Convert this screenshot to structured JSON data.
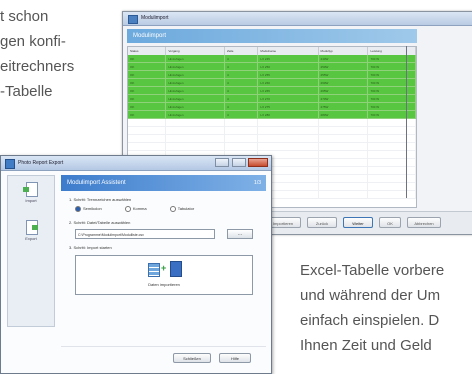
{
  "prose_top": [
    "t schon",
    "gen konfi-",
    "eitrechners",
    "-Tabelle"
  ],
  "prose_bottom": [
    "Excel-Tabelle vorbere",
    "und während der Um",
    "einfach einspielen. D",
    "Ihnen Zeit und Geld"
  ],
  "back_window": {
    "title": "Modulimport",
    "banner": "Modulimport",
    "columns": [
      "Status",
      "Vorgang",
      "Zeile",
      "Modulname",
      "Modultyp",
      "Leistung"
    ],
    "rows": [
      [
        "OK",
        "Hinzufügen",
        "4",
        "LX 245",
        "240W",
        "700 W"
      ],
      [
        "OK",
        "Hinzufügen",
        "4",
        "LX 250",
        "250W",
        "700 W"
      ],
      [
        "OK",
        "Hinzufügen",
        "4",
        "LX 255",
        "255W",
        "700 W"
      ],
      [
        "OK",
        "Hinzufügen",
        "4",
        "LX 260",
        "260W",
        "700 W"
      ],
      [
        "OK",
        "Hinzufügen",
        "4",
        "LX 265",
        "265W",
        "700 W"
      ],
      [
        "OK",
        "Hinzufügen",
        "4",
        "LX 270",
        "270W",
        "700 W"
      ],
      [
        "OK",
        "Hinzufügen",
        "4",
        "LX 275",
        "275W",
        "700 W"
      ],
      [
        "OK",
        "Hinzufügen",
        "4",
        "LX 280",
        "280W",
        "700 W"
      ]
    ],
    "buttons": [
      "Importieren",
      "Zurück",
      "Weiter",
      "OK",
      "Abbrechen"
    ]
  },
  "front_window": {
    "title": "Photo Report Export",
    "sidebar": [
      "Import",
      "Export"
    ],
    "header": "Modulimport Assistent",
    "header_badge": "1/3",
    "step1": "1. Schritt: Trennzeichen auswählen",
    "radio_options": [
      "Semikolon",
      "Komma",
      "Tabulator"
    ],
    "step2": "2. Schritt: Datei/Tabelle auswählen",
    "path_value": "C:\\Programme\\Modulimport\\Modulliste.csv",
    "browse_label": "...",
    "step3": "3. Schritt: Import starten",
    "import_label": "Daten importieren",
    "buttons": [
      "Schließen",
      "Hilfe"
    ]
  },
  "colors": {
    "accent": "#3d7ccc",
    "row_ok": "#58c640"
  }
}
